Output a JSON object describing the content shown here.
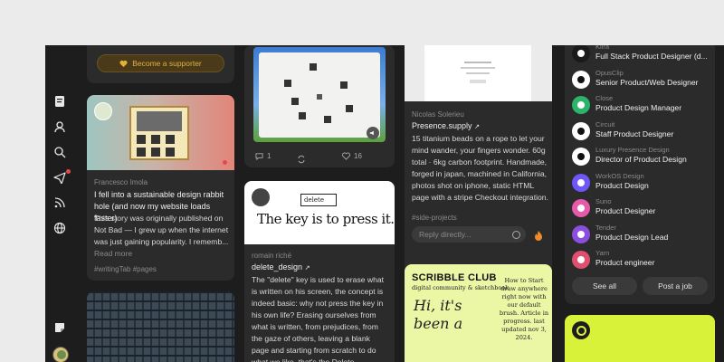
{
  "rail": {
    "icons": [
      "notes-icon",
      "user-icon",
      "search-icon",
      "send-icon",
      "rss-icon",
      "globe-icon",
      "sticker-icon",
      "avatar"
    ]
  },
  "supporter": {
    "label": "Become a supporter"
  },
  "post1": {
    "author": "Francesco Imola",
    "title": "I fell into a sustainable design rabbit hole (and now my website loads faster)",
    "body": "This story was originally published on Not Bad — I grew up when the internet was just gaining popularity. I rememb...",
    "more": "Read more",
    "tags": "#writingTab #pages"
  },
  "post2": {
    "comments": "1",
    "likes": "16"
  },
  "post3": {
    "image_text": "The key is to press it.",
    "key_text": "delete",
    "author": "romain riché",
    "title": "delete_design",
    "body": "The \"delete\" key is used to erase what is written on his screen, the concept is indeed basic: why not press the key in his own life? Erasing ourselves from what is written, from prejudices, from the gaze of others, leaving a blank page and starting from scratch to do what we like, that's the Delete"
  },
  "post4": {
    "author": "Nicolas Solerieu",
    "title": "Presence.supply",
    "body": "15 titanium beads on a rope to let your mind wander, your fingers wonder. 60g total · 6kg carbon footprint. Handmade, forged in japan, machined in California, photos shot on iphone, static HTML page with a stripe Checkout integration.",
    "tags": "#side-projects",
    "reply_placeholder": "Reply directly..."
  },
  "post5": {
    "title": "SCRIBBLE CLUB",
    "subtitle": "digital community & sketchbook",
    "hand": "Hi, it's been a",
    "note": "How to Start draw anywhere right now with our default brush. Article in progress. last updated nov 3, 2024."
  },
  "jobs": [
    {
      "company": "Kiira",
      "role": "Full Stack Product Designer (d...",
      "color": "#1a1a1a",
      "icon": "waveform-icon"
    },
    {
      "company": "OpusClip",
      "role": "Senior Product/Web Designer",
      "color": "#ffffff",
      "icon": "opusclip-logo-icon"
    },
    {
      "company": "Close",
      "role": "Product Design Manager",
      "color": "#2db36b",
      "icon": "close-logo-icon"
    },
    {
      "company": "Circuit",
      "role": "Staff Product Designer",
      "color": "#ffffff",
      "icon": "circuit-logo-icon"
    },
    {
      "company": "Luxury Presence Design",
      "role": "Director of Product Design",
      "color": "#ffffff",
      "icon": "pin-logo-icon"
    },
    {
      "company": "WorkOS Design",
      "role": "Product Design",
      "color": "#6e56f8",
      "icon": "workos-logo-icon"
    },
    {
      "company": "Suno",
      "role": "Product Designer",
      "color": "#e55aa9",
      "icon": "suno-logo-icon"
    },
    {
      "company": "Tender",
      "role": "Product Design Lead",
      "color": "#8b4fe0",
      "icon": "heart-logo-icon"
    },
    {
      "company": "Yarn",
      "role": "Product engineer",
      "color": "#e0506e",
      "icon": "yarn-logo-icon"
    }
  ],
  "jobs_actions": {
    "see_all": "See all",
    "post_job": "Post a job"
  },
  "colors": {
    "accent": "#e0b23a",
    "lime": "#d8f23a"
  }
}
